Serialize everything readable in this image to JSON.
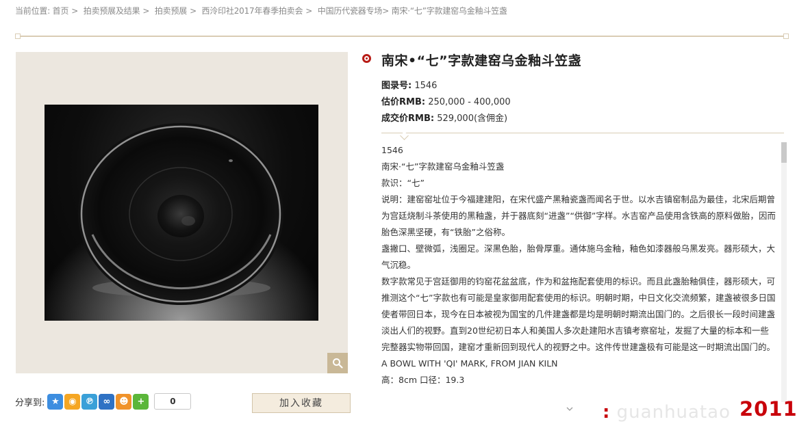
{
  "breadcrumb": {
    "prefix": "当前位置:",
    "items": [
      "首页",
      "拍卖预展及结果",
      "拍卖预展",
      "西泠印社2017年春季拍卖会",
      "中国历代瓷器专场"
    ],
    "current": "南宋·“七”字款建窑乌金釉斗笠盏"
  },
  "lot": {
    "title": "南宋•“七”字款建窑乌金釉斗笠盏",
    "catalog_label": "图录号:",
    "catalog_value": "1546",
    "estimate_label": "估价RMB:",
    "estimate_value": "250,000 - 400,000",
    "hammer_label": "成交价RMB:",
    "hammer_value": "529,000(含佣金)"
  },
  "description": [
    "1546",
    "南宋·“七”字款建窑乌金釉斗笠盏",
    "款识：“七”",
    "说明：建窑窑址位于今福建建阳，在宋代盛产黑釉瓷盏而闻名于世。以水吉镇窑制品为最佳，北宋后期曾为宫廷烧制斗茶使用的黑釉盏，并于器底刻“进盏”“供御”字样。水吉窑产品使用含铁高的原料做胎，因而胎色深黑坚硬，有“铁胎”之俗称。",
    "盏撇口、壁微弧，浅圈足。深黑色胎，胎骨厚重。通体施乌金釉，釉色如漆器般乌黑发亮。器形硕大，大气沉稳。",
    "数字款常见于宫廷御用的钧窑花盆盆底，作为和盆拖配套使用的标识。而且此盏胎釉俱佳，器形硕大，可推测这个“七”字款也有可能是皇家御用配套使用的标识。明朝时期，中日文化交流频繁，建盏被很多日国使者带回日本，现今在日本被视为国宝的几件建盏都是均是明朝时期流出国门的。之后很长一段时间建盏淡出人们的视野。直到20世纪初日本人和美国人多次赴建阳水吉镇考察窑址，发掘了大量的标本和一些完整器实物带回国，建窑才重新回到现代人的视野之中。这件传世建盏极有可能是这一时期流出国门的。",
    "A BOWL WITH 'QI' MARK, FROM JIAN KILN",
    "高：8cm 口径：19.3"
  ],
  "share": {
    "label": "分享到:",
    "count": "0",
    "icons": [
      {
        "name": "qzone-icon",
        "color": "#3d8ee0",
        "glyph": "★"
      },
      {
        "name": "weibo-icon",
        "color": "#f5a623",
        "glyph": "◉"
      },
      {
        "name": "tqq-icon",
        "color": "#3aa0d8",
        "glyph": "℗"
      },
      {
        "name": "renren-icon",
        "color": "#2f72c4",
        "glyph": "∞"
      },
      {
        "name": "qqfriend-icon",
        "color": "#f0932b",
        "glyph": "☻"
      },
      {
        "name": "more-icon",
        "color": "#5bb63a",
        "glyph": "+"
      }
    ]
  },
  "favorite_label": "加入收藏",
  "watermark": {
    "colon": ":",
    "text": "guanhuatao",
    "year": "2011"
  },
  "colors": {
    "accent": "#b81c16",
    "gold_line": "#d9ccb4",
    "photo_bg": "#ece7df",
    "zoom_bg": "#c9b897",
    "watermark_red": "#c8000a"
  }
}
